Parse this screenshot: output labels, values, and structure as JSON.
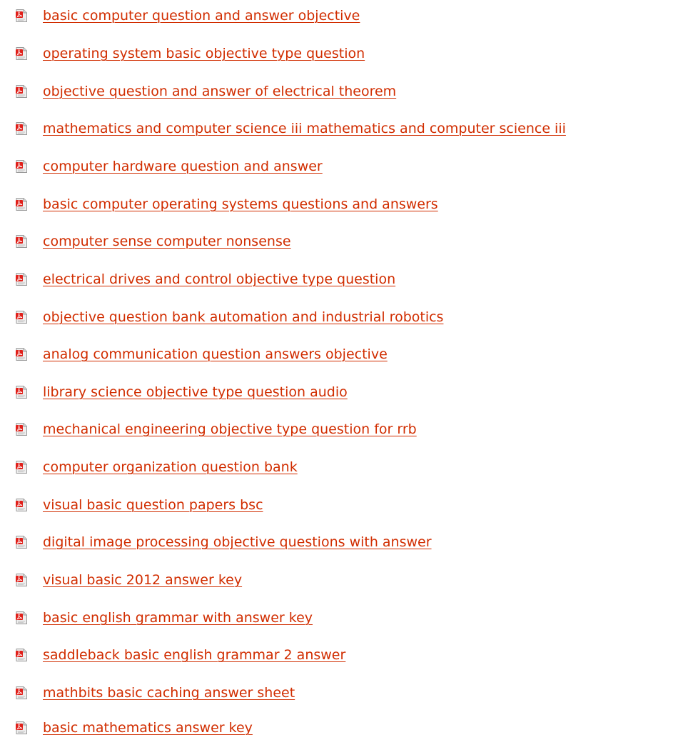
{
  "links": [
    {
      "label": "basic computer question and answer objective",
      "icon": "pdf-file-icon"
    },
    {
      "label": "operating system basic objective type question",
      "icon": "pdf-file-icon"
    },
    {
      "label": "objective question and answer of electrical theorem",
      "icon": "pdf-file-icon"
    },
    {
      "label": "mathematics and computer science iii mathematics and computer science iii",
      "icon": "pdf-file-icon"
    },
    {
      "label": "computer hardware question and answer",
      "icon": "pdf-file-icon"
    },
    {
      "label": "basic computer operating systems questions and answers",
      "icon": "pdf-file-icon"
    },
    {
      "label": "computer sense computer nonsense",
      "icon": "pdf-file-icon"
    },
    {
      "label": "electrical drives and control objective type question",
      "icon": "pdf-file-icon"
    },
    {
      "label": "objective question bank automation and industrial robotics",
      "icon": "pdf-file-icon"
    },
    {
      "label": "analog communication question answers objective",
      "icon": "pdf-file-icon"
    },
    {
      "label": "library science objective type question audio",
      "icon": "pdf-file-icon"
    },
    {
      "label": "mechanical engineering objective type question for rrb",
      "icon": "pdf-file-icon"
    },
    {
      "label": "computer organization question bank",
      "icon": "pdf-file-icon"
    },
    {
      "label": "visual basic question papers bsc",
      "icon": "pdf-file-icon"
    },
    {
      "label": "digital image processing objective questions with answer",
      "icon": "pdf-file-icon"
    },
    {
      "label": "visual basic 2012 answer key",
      "icon": "pdf-file-icon"
    },
    {
      "label": "basic english grammar with answer key",
      "icon": "pdf-file-icon"
    },
    {
      "label": "saddleback basic english grammar 2 answer",
      "icon": "pdf-file-icon"
    },
    {
      "label": "mathbits basic caching answer sheet",
      "icon": "pdf-file-icon"
    },
    {
      "label": "basic mathematics answer key",
      "icon": "pdf-file-icon"
    }
  ],
  "colors": {
    "link": "#d12d00",
    "icon_red": "#e0201a",
    "icon_page": "#eeeeee"
  }
}
